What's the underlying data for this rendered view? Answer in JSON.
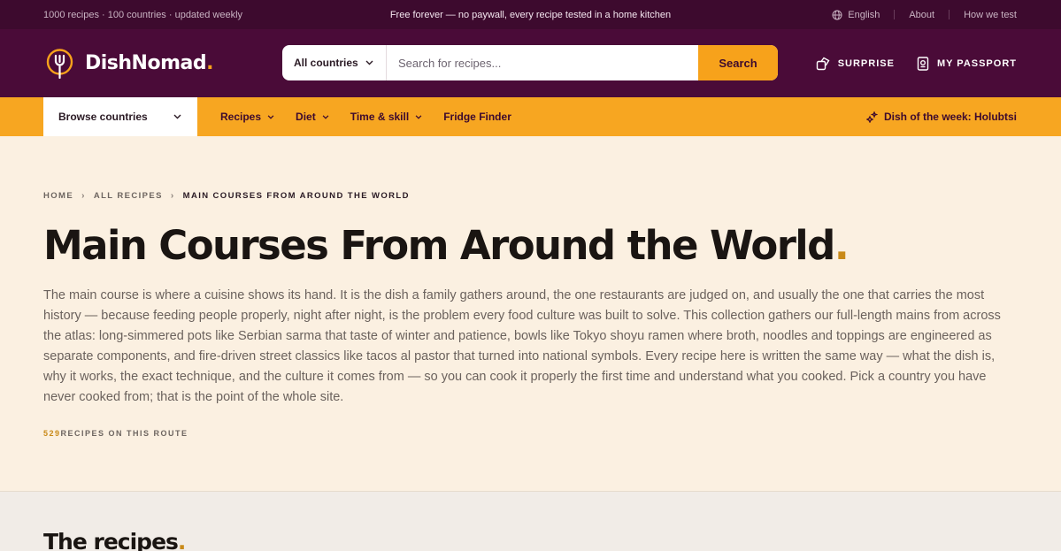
{
  "topbar": {
    "left": "1000 recipes · 100 countries · updated weekly",
    "center": "Free forever — no paywall, every recipe tested in a home kitchen",
    "language": "English",
    "about": "About",
    "how_we_test": "How we test"
  },
  "header": {
    "brand": "DishNomad",
    "brand_dot": ".",
    "search": {
      "scope": "All countries",
      "placeholder": "Search for recipes...",
      "button": "Search"
    },
    "surprise": "SURPRISE",
    "passport": "MY PASSPORT"
  },
  "nav": {
    "browse": "Browse countries",
    "links": [
      "Recipes",
      "Diet",
      "Time & skill",
      "Fridge Finder"
    ],
    "dish_of_week": "Dish of the week: Holubtsi"
  },
  "hero": {
    "breadcrumb": [
      "HOME",
      "ALL RECIPES",
      "MAIN COURSES FROM AROUND THE WORLD"
    ],
    "title": "Main Courses From Around the World",
    "title_dot": ".",
    "description": "The main course is where a cuisine shows its hand. It is the dish a family gathers around, the one restaurants are judged on, and usually the one that carries the most history — because feeding people properly, night after night, is the problem every food culture was built to solve. This collection gathers our full-length mains from across the atlas: long-simmered pots like Serbian sarma that taste of winter and patience, bowls like Tokyo shoyu ramen where broth, noodles and toppings are engineered as separate components, and fire-driven street classics like tacos al pastor that turned into national symbols. Every recipe here is written the same way — what the dish is, why it works, the exact technique, and the culture it comes from — so you can cook it properly the first time and understand what you cooked. Pick a country you have never cooked from; that is the point of the whole site.",
    "count_number": "529",
    "count_label": "RECIPES ON THIS ROUTE"
  },
  "recipes": {
    "heading": "The recipes",
    "heading_dot": "."
  },
  "colors": {
    "topbar_bg": "#3d0a2e",
    "header_bg": "#4a0b38",
    "accent": "#f7a21b",
    "hero_bg": "#fbf0e1"
  }
}
